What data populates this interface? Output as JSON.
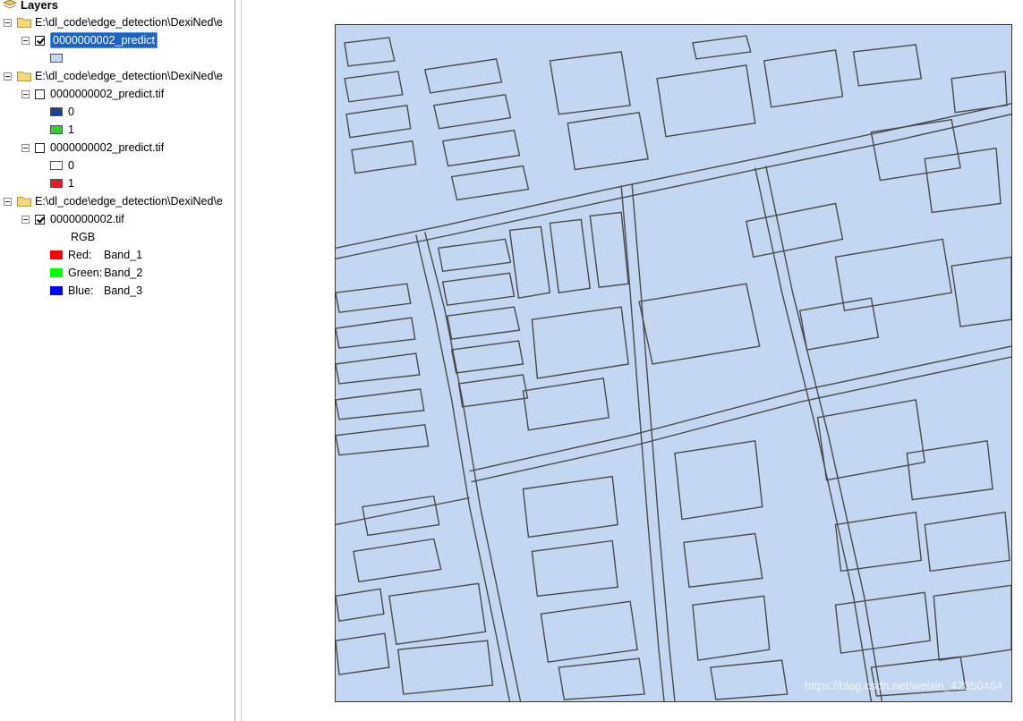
{
  "toc": {
    "root_label": "Layers",
    "groups": [
      {
        "path": "E:\\dl_code\\edge_detection\\DexiNed\\e",
        "layers": [
          {
            "name": "0000000002_predict",
            "checked": true,
            "selected": true,
            "legend": [
              {
                "label": "",
                "color": "#c3d7f3"
              }
            ]
          }
        ]
      },
      {
        "path": "E:\\dl_code\\edge_detection\\DexiNed\\e",
        "layers": [
          {
            "name": "0000000002_predict.tif",
            "checked": false,
            "legend": [
              {
                "label": "0",
                "color": "#1f3f8f"
              },
              {
                "label": "1",
                "color": "#33cc33"
              }
            ]
          },
          {
            "name": "0000000002_predict.tif",
            "checked": false,
            "legend": [
              {
                "label": "0",
                "color": "#ffffff"
              },
              {
                "label": "1",
                "color": "#e02020"
              }
            ]
          }
        ]
      },
      {
        "path": "E:\\dl_code\\edge_detection\\DexiNed\\e",
        "layers": [
          {
            "name": "0000000002.tif",
            "checked": true,
            "rgb_label": "RGB",
            "bands": [
              {
                "channel": "Red:",
                "band": "Band_1",
                "color": "#ff0000"
              },
              {
                "channel": "Green:",
                "band": "Band_2",
                "color": "#00ff00"
              },
              {
                "channel": "Blue:",
                "band": "Band_3",
                "color": "#0000ff"
              }
            ]
          }
        ]
      }
    ]
  },
  "map": {
    "fill_color": "#c3d7f3",
    "edge_color": "#4a4a4a",
    "watermark": "https://blog.csdn.net/weixin_42350464"
  }
}
